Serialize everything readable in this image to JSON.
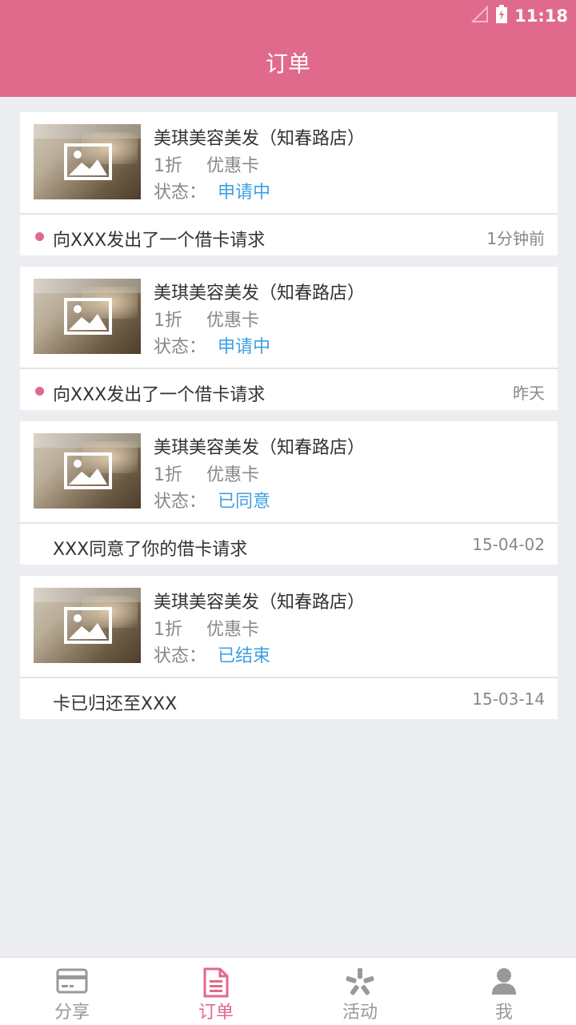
{
  "status_bar": {
    "time": "11:18"
  },
  "header": {
    "title": "订单"
  },
  "cards": [
    {
      "shop_name": "美琪美容美发（知春路店）",
      "discount": "1折",
      "card_type": "优惠卡",
      "status_label": "状态：",
      "status_value": "申请中",
      "message": "向XXX发出了一个借卡请求",
      "time": "1分钟前",
      "unread": true
    },
    {
      "shop_name": "美琪美容美发（知春路店）",
      "discount": "1折",
      "card_type": "优惠卡",
      "status_label": "状态：",
      "status_value": "申请中",
      "message": "向XXX发出了一个借卡请求",
      "time": "昨天",
      "unread": true
    },
    {
      "shop_name": "美琪美容美发（知春路店）",
      "discount": "1折",
      "card_type": "优惠卡",
      "status_label": "状态：",
      "status_value": "已同意",
      "message": "XXX同意了你的借卡请求",
      "time": "15-04-02",
      "unread": false
    },
    {
      "shop_name": "美琪美容美发（知春路店）",
      "discount": "1折",
      "card_type": "优惠卡",
      "status_label": "状态：",
      "status_value": "已结束",
      "message": "卡已归还至XXX",
      "time": "15-03-14",
      "unread": false
    }
  ],
  "tabs": [
    {
      "label": "分享",
      "icon": "card-icon",
      "active": false
    },
    {
      "label": "订单",
      "icon": "document-icon",
      "active": true
    },
    {
      "label": "活动",
      "icon": "pinwheel-icon",
      "active": false
    },
    {
      "label": "我",
      "icon": "person-icon",
      "active": false
    }
  ],
  "colors": {
    "brand": "#e06a8b",
    "status_blue": "#3f9fe3",
    "background": "#ecedf0"
  }
}
